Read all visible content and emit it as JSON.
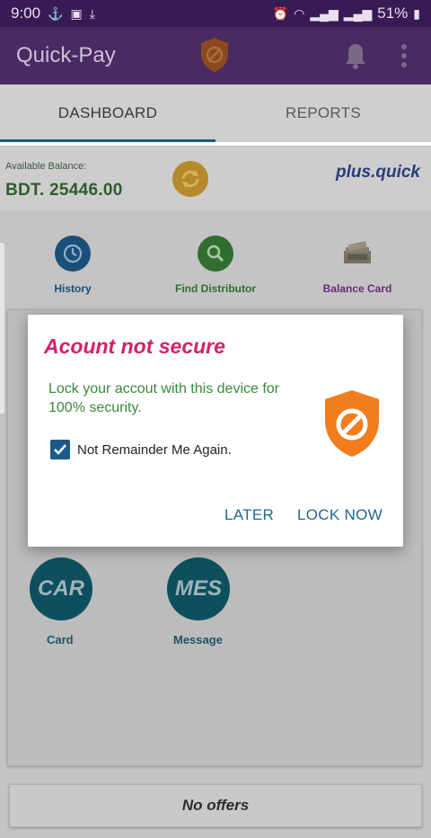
{
  "status_bar": {
    "time": "9:00",
    "battery": "51%",
    "left_icons": [
      "notification-icon",
      "image-icon",
      "download-icon"
    ],
    "right_icons": [
      "alarm-icon",
      "wifi-icon",
      "signal-icon",
      "signal-icon",
      "battery-icon"
    ]
  },
  "app_bar": {
    "title": "Quick-Pay",
    "icons": [
      "shield-block-icon",
      "bell-icon",
      "more-vert-icon"
    ],
    "color": "#4a2a63"
  },
  "tabs": [
    {
      "label": "DASHBOARD",
      "active": true
    },
    {
      "label": "REPORTS",
      "active": false
    }
  ],
  "balance": {
    "label": "Available Balance:",
    "value": "BDT. 25446.00",
    "brand": "plus.quick",
    "refresh_icon": "refresh-icon"
  },
  "features": [
    {
      "label": "History",
      "icon": "history-clock-icon",
      "color": "#1b4f7a"
    },
    {
      "label": "Find Distributor",
      "icon": "search-icon",
      "color": "#2f6e2f"
    },
    {
      "label": "Balance Card",
      "icon": "cash-stack-icon",
      "color": "#6a2a7a"
    }
  ],
  "circle_buttons": [
    {
      "text": "CAR",
      "label": "Card"
    },
    {
      "text": "MES",
      "label": "Message"
    }
  ],
  "offers": {
    "text": "No offers"
  },
  "dialog": {
    "title": "Acount not secure",
    "message": "Lock your accout with this device for 100% security.",
    "checkbox_label": "Not  Remainder Me Again.",
    "checked": true,
    "later_button": "LATER",
    "lock_button": "LOCK NOW",
    "icon": "shield-block-icon",
    "colors": {
      "title": "#d4206a",
      "message": "#3a8a3a",
      "buttons": "#1d6a8a",
      "shield": "#f07e1e"
    }
  }
}
